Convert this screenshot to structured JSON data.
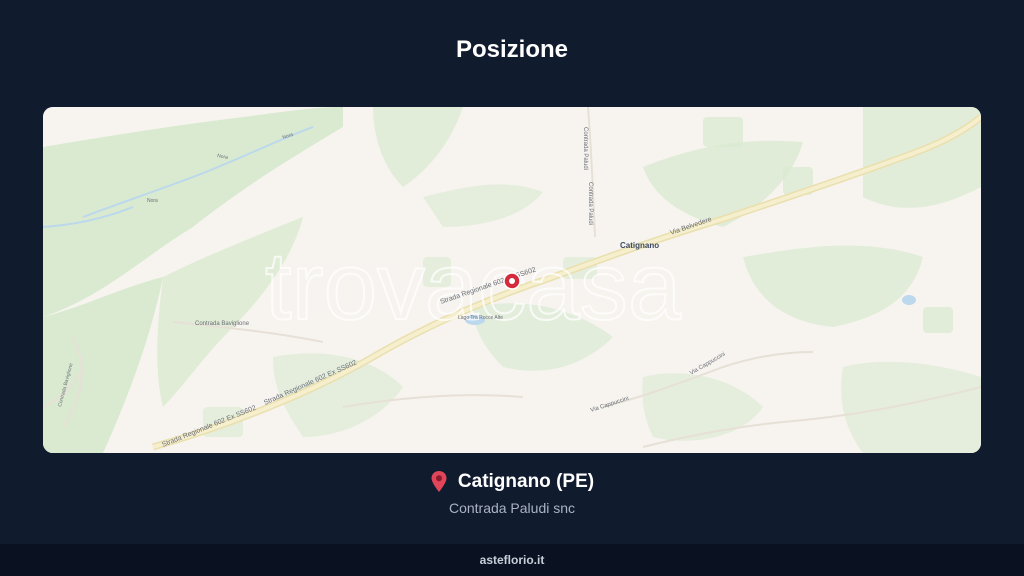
{
  "page": {
    "title": "Posizione"
  },
  "map": {
    "watermark": "trovacasa",
    "place_label": "Catignano",
    "road_labels": {
      "sr602_a": "Strada Regionale 602 Ex SS602",
      "sr602_b": "Strada Regionale 602 Ex SS602",
      "sr602_c": "Strada Regionale 602 Ex SS602",
      "belvedere": "Via Belvedere",
      "paludi_1": "Contrada Paludi",
      "paludi_2": "Contrada Paludi",
      "baviglione": "Contrada Baviglione",
      "cappuccini_1": "Via Cappuccini",
      "cappuccini_2": "Via Cappuccini",
      "river_1": "Nora",
      "river_2": "Nora",
      "river_3": "Nora",
      "lake": "Lago Tra Rocce Alte",
      "left_road": "Contrada Baviglione"
    },
    "colors": {
      "land": "#f7f4ef",
      "green": "#d9ead0",
      "road": "#f3eccb",
      "water": "#bcd8ec",
      "marker": "#d32b3c"
    }
  },
  "location": {
    "city": "Catignano (PE)",
    "address": "Contrada Paludi snc",
    "icon": "pin-icon"
  },
  "footer": {
    "brand": "asteflorio.it"
  }
}
